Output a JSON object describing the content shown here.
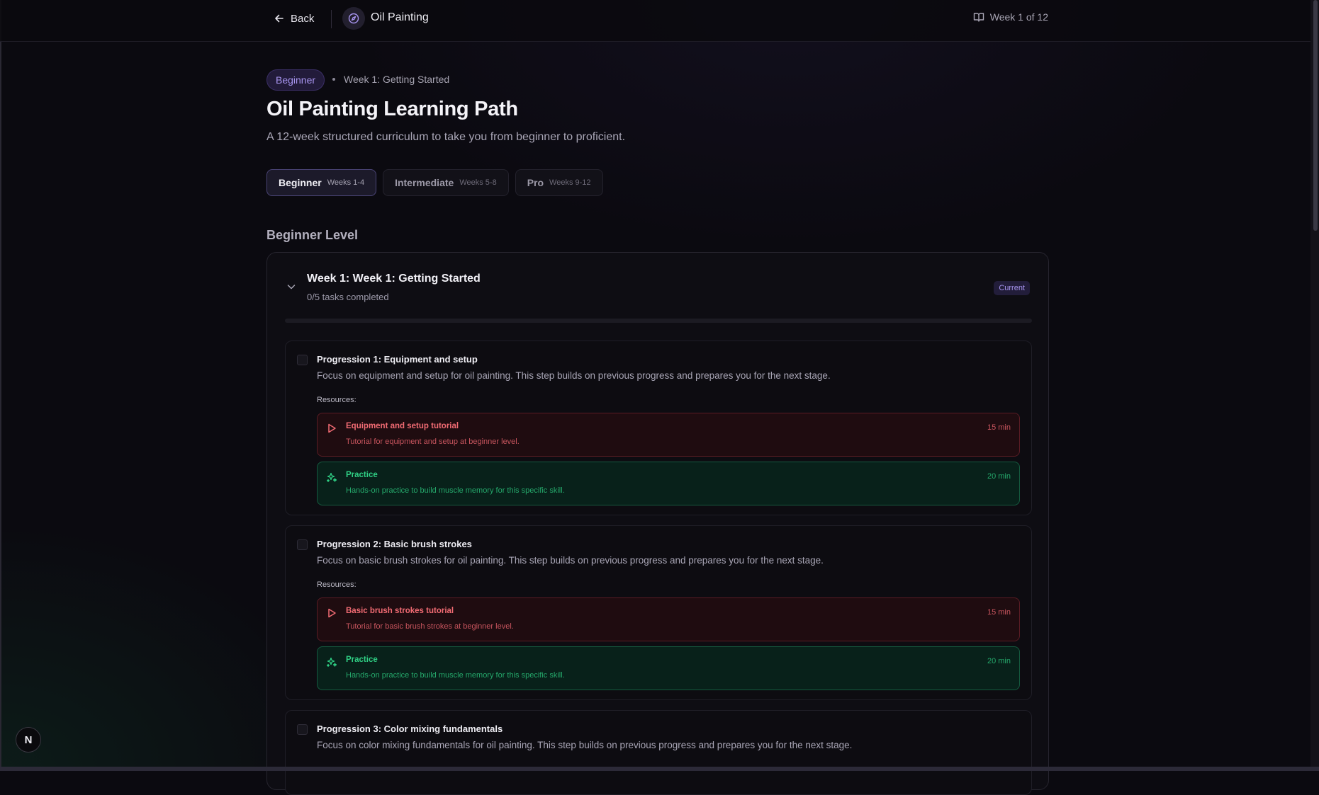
{
  "topbar": {
    "back_label": "Back",
    "course_name": "Oil Painting",
    "week_indicator": "Week 1 of 12"
  },
  "header": {
    "level_badge": "Beginner",
    "breadcrumb": "Week 1: Getting Started",
    "title": "Oil Painting Learning Path",
    "subtitle": "A 12-week structured curriculum to take you from beginner to proficient."
  },
  "level_tabs": [
    {
      "name": "Beginner",
      "range": "Weeks 1-4",
      "active": true
    },
    {
      "name": "Intermediate",
      "range": "Weeks 5-8",
      "active": false
    },
    {
      "name": "Pro",
      "range": "Weeks 9-12",
      "active": false
    }
  ],
  "section_title": "Beginner Level",
  "week": {
    "title": "Week 1: Week 1: Getting Started",
    "tasks_completed": "0/5 tasks completed",
    "progress": 0,
    "status_badge": "Current"
  },
  "tasks": [
    {
      "title": "Progression 1: Equipment and setup",
      "description": "Focus on equipment and setup for oil painting. This step builds on previous progress and prepares you for the next stage.",
      "resources_label": "Resources:",
      "resources": [
        {
          "kind": "video",
          "icon": "play-icon",
          "title": "Equipment and setup tutorial",
          "description": "Tutorial for equipment and setup at beginner level.",
          "duration": "15 min"
        },
        {
          "kind": "practice",
          "icon": "sparkles-icon",
          "title": "Practice",
          "description": "Hands-on practice to build muscle memory for this specific skill.",
          "duration": "20 min"
        }
      ]
    },
    {
      "title": "Progression 2: Basic brush strokes",
      "description": "Focus on basic brush strokes for oil painting. This step builds on previous progress and prepares you for the next stage.",
      "resources_label": "Resources:",
      "resources": [
        {
          "kind": "video",
          "icon": "play-icon",
          "title": "Basic brush strokes tutorial",
          "description": "Tutorial for basic brush strokes at beginner level.",
          "duration": "15 min"
        },
        {
          "kind": "practice",
          "icon": "sparkles-icon",
          "title": "Practice",
          "description": "Hands-on practice to build muscle memory for this specific skill.",
          "duration": "20 min"
        }
      ]
    },
    {
      "title": "Progression 3: Color mixing fundamentals",
      "description": "Focus on color mixing fundamentals for oil painting. This step builds on previous progress and prepares you for the next stage."
    }
  ],
  "dev_badge": "N",
  "colors": {
    "accent": "#a895f0",
    "video": "#f16b73",
    "practice": "#2fcf84",
    "background": "#0b0a10"
  }
}
